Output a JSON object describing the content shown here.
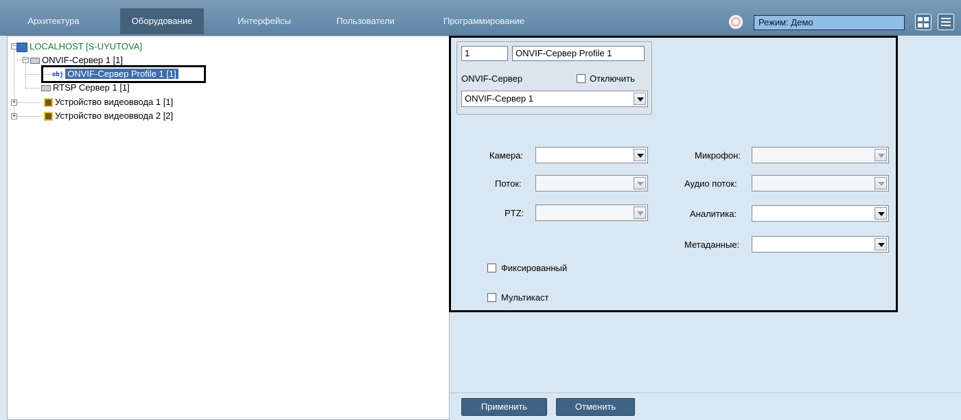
{
  "nav": {
    "tabs": [
      {
        "label": "Архитектура"
      },
      {
        "label": "Оборудование"
      },
      {
        "label": "Интерфейсы"
      },
      {
        "label": "Пользователи"
      },
      {
        "label": "Программирование"
      }
    ],
    "active_tab": "Оборудование",
    "mode_label": "Режим: Демо"
  },
  "tree": {
    "root": "LOCALHOST [S-UYUTOVA]",
    "server": "ONVIF-Сервер 1 [1]",
    "profile_prefix": "obj",
    "profile": "ONVIF-Сервер Profile 1 [1]",
    "rtsp": "RTSP Сервер 1 [1]",
    "device1": "Устройство видеоввода 1 [1]",
    "device2": "Устройство видеоввода 2 [2]"
  },
  "settings": {
    "id_value": "1",
    "name_value": "ONVIF-Сервер Profile 1",
    "server_label": "ONVIF-Сервер",
    "disable_label": "Отключить",
    "server_select": "ONVIF-Сервер 1",
    "camera_label": "Камера:",
    "stream_label": "Поток:",
    "ptz_label": "PTZ:",
    "mic_label": "Микрофон:",
    "audio_label": "Аудио поток:",
    "analytics_label": "Аналитика:",
    "metadata_label": "Метаданные:",
    "fixed_label": "Фиксированный",
    "multicast_label": "Мультикаст"
  },
  "footer": {
    "apply_label": "Применить",
    "cancel_label": "Отменить"
  },
  "colors": {
    "topbar": "#6a8fae",
    "active_tab": "#45627c",
    "mode_box": "#8fbde6",
    "pane_bg": "#d9e7f2",
    "button": "#3f6385",
    "selection": "#3e6ca8"
  }
}
